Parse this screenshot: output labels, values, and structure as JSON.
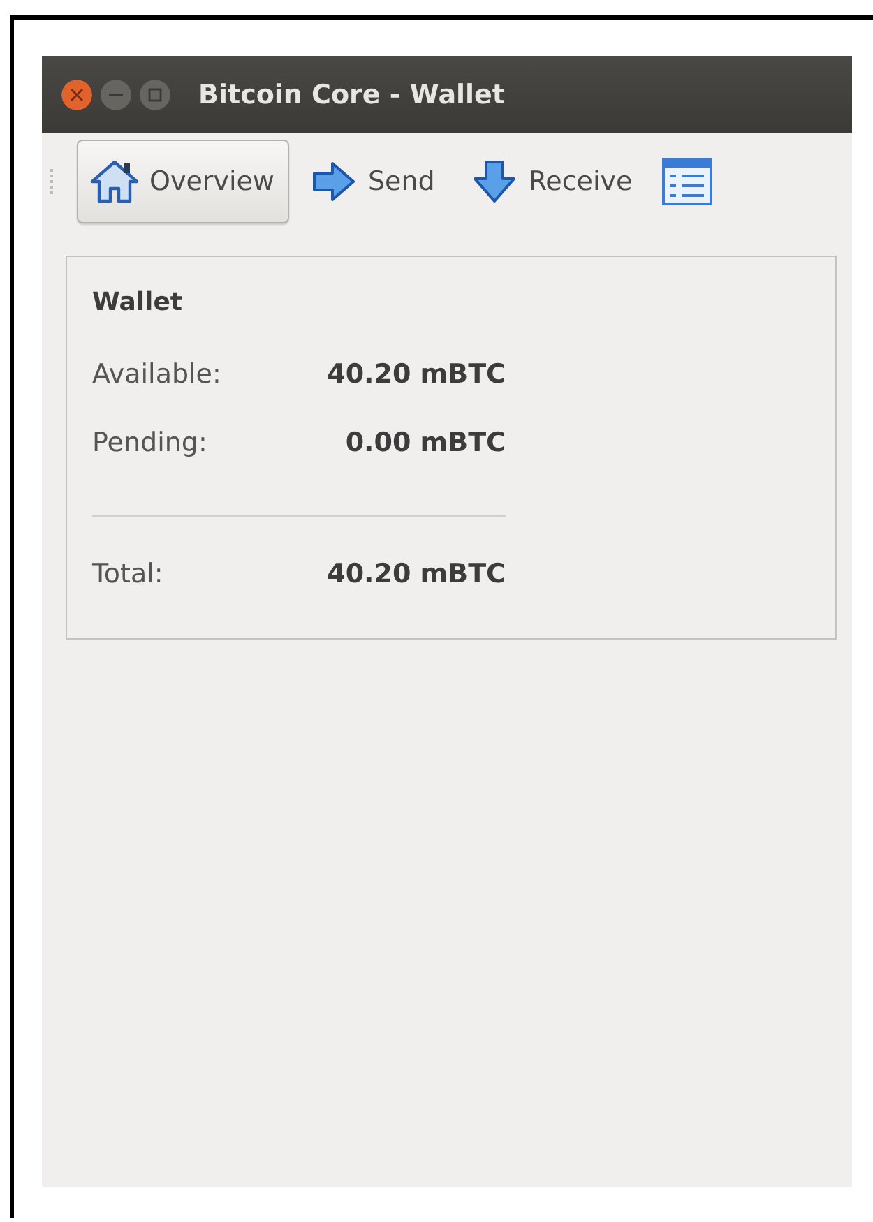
{
  "window": {
    "title": "Bitcoin Core - Wallet"
  },
  "toolbar": {
    "items": [
      {
        "label": "Overview",
        "selected": true
      },
      {
        "label": "Send",
        "selected": false
      },
      {
        "label": "Receive",
        "selected": false
      }
    ]
  },
  "wallet": {
    "title": "Wallet",
    "rows": [
      {
        "label": "Available:",
        "value": "40.20 mBTC"
      },
      {
        "label": "Pending:",
        "value": "0.00 mBTC"
      }
    ],
    "total": {
      "label": "Total:",
      "value": "40.20 mBTC"
    }
  }
}
